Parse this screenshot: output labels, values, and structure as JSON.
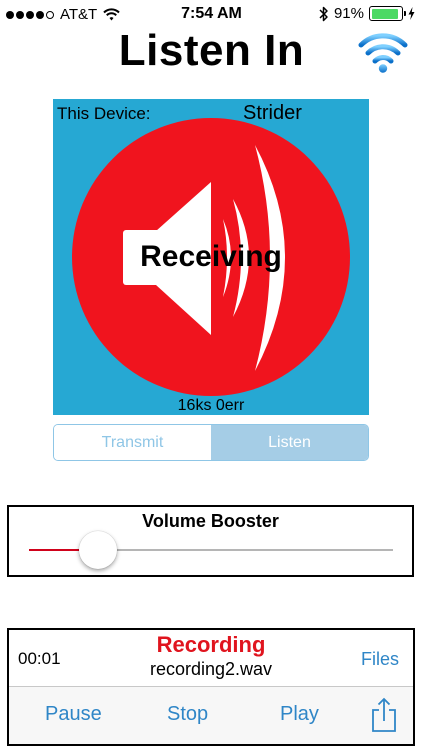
{
  "status_bar": {
    "carrier": "AT&T",
    "time": "7:54 AM",
    "battery": "91%",
    "battery_level": 0.91,
    "signal_bars": 4
  },
  "header": {
    "title": "Listen In"
  },
  "device": {
    "label": "This Device:",
    "name": "Strider",
    "state": "Receiving",
    "stats": "16ks 0err"
  },
  "mode": {
    "options": [
      "Transmit",
      "Listen"
    ],
    "selected": "Listen"
  },
  "volume": {
    "title": "Volume Booster",
    "level": 0.19
  },
  "recording": {
    "elapsed": "00:01",
    "status": "Recording",
    "file_name": "recording2.wav",
    "files_label": "Files",
    "pause_label": "Pause",
    "stop_label": "Stop",
    "play_label": "Play"
  },
  "colors": {
    "panel_blue": "#26a8d3",
    "circle_red": "#f0141e",
    "accent_blue": "#2f86c7",
    "recording_red": "#e0141e",
    "battery_green": "#4cd964"
  },
  "icons": {
    "header_button": "wifi-icon",
    "state_graphic": "speaker-icon",
    "share": "share-icon"
  }
}
